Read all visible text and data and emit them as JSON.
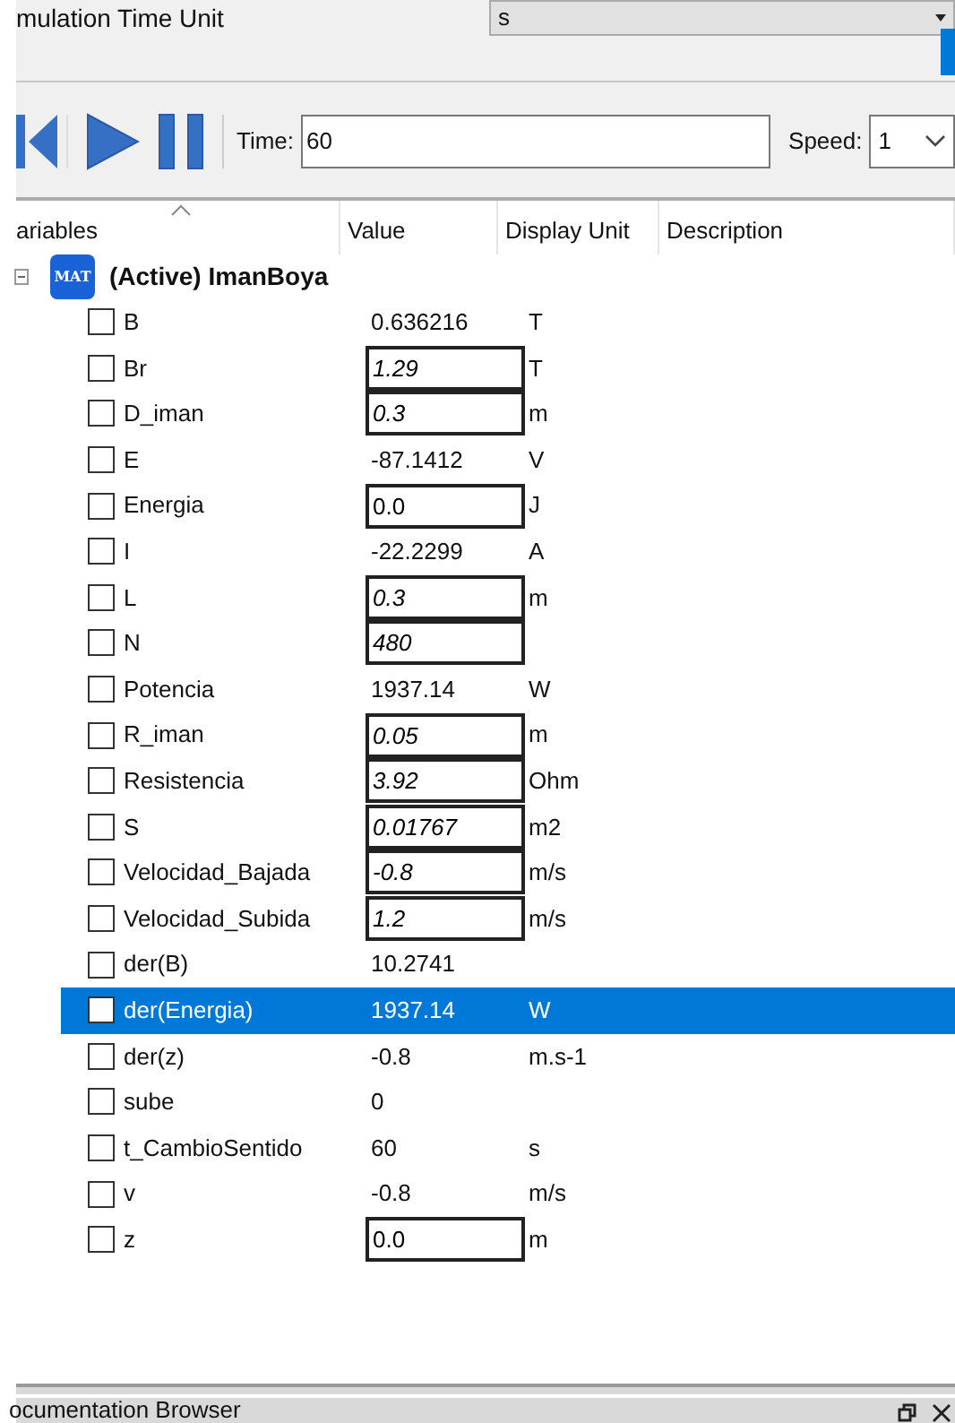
{
  "settings": {
    "label": "mulation Time Unit",
    "time_unit": "s"
  },
  "toolbar": {
    "time_label": "Time:",
    "time_value": "60",
    "speed_label": "Speed:",
    "speed_value": "1"
  },
  "table": {
    "columns": [
      "ariables",
      "Value",
      "Display Unit",
      "Description"
    ],
    "group": {
      "expanded": true,
      "icon_text": "MAT",
      "title": "(Active) ImanBoya"
    },
    "rows": [
      {
        "name": "B",
        "value": "0.636216",
        "unit": "T",
        "kind": "output",
        "checked": false,
        "selected": false
      },
      {
        "name": "Br",
        "value": "1.29",
        "unit": "T",
        "kind": "parameter",
        "checked": false,
        "selected": false
      },
      {
        "name": "D_iman",
        "value": "0.3",
        "unit": "m",
        "kind": "parameter",
        "checked": false,
        "selected": false
      },
      {
        "name": "E",
        "value": "-87.1412",
        "unit": "V",
        "kind": "output",
        "checked": false,
        "selected": false
      },
      {
        "name": "Energia",
        "value": "0.0",
        "unit": "J",
        "kind": "state",
        "checked": false,
        "selected": false
      },
      {
        "name": "I",
        "value": "-22.2299",
        "unit": "A",
        "kind": "output",
        "checked": false,
        "selected": false
      },
      {
        "name": "L",
        "value": "0.3",
        "unit": "m",
        "kind": "parameter",
        "checked": false,
        "selected": false
      },
      {
        "name": "N",
        "value": "480",
        "kind": "parameter",
        "checked": false,
        "selected": false
      },
      {
        "name": "Potencia",
        "value": "1937.14",
        "unit": "W",
        "kind": "output",
        "checked": false,
        "selected": false
      },
      {
        "name": "R_iman",
        "value": "0.05",
        "unit": "m",
        "kind": "parameter",
        "checked": false,
        "selected": false
      },
      {
        "name": "Resistencia",
        "value": "3.92",
        "unit": "Ohm",
        "kind": "parameter",
        "checked": false,
        "selected": false
      },
      {
        "name": "S",
        "value": "0.01767",
        "unit": "m2",
        "kind": "parameter",
        "checked": false,
        "selected": false
      },
      {
        "name": "Velocidad_Bajada",
        "value": "-0.8",
        "unit": "m/s",
        "kind": "parameter",
        "checked": false,
        "selected": false
      },
      {
        "name": "Velocidad_Subida",
        "value": "1.2",
        "unit": "m/s",
        "kind": "parameter",
        "checked": false,
        "selected": false
      },
      {
        "name": "der(B)",
        "value": "10.2741",
        "kind": "output",
        "checked": false,
        "selected": false
      },
      {
        "name": "der(Energia)",
        "value": "1937.14",
        "unit": "W",
        "kind": "output",
        "checked": false,
        "selected": true
      },
      {
        "name": "der(z)",
        "value": "-0.8",
        "unit": "m.s-1",
        "kind": "output",
        "checked": false,
        "selected": false
      },
      {
        "name": "sube",
        "value": "0",
        "kind": "output",
        "checked": false,
        "selected": false
      },
      {
        "name": "t_CambioSentido",
        "value": "60",
        "unit": "s",
        "kind": "output",
        "checked": false,
        "selected": false
      },
      {
        "name": "v",
        "value": "-0.8",
        "unit": "m/s",
        "kind": "output",
        "checked": false,
        "selected": false
      },
      {
        "name": "z",
        "value": "0.0",
        "unit": "m",
        "kind": "state",
        "checked": false,
        "selected": false
      }
    ]
  },
  "dock": {
    "title": "ocumentation Browser"
  }
}
